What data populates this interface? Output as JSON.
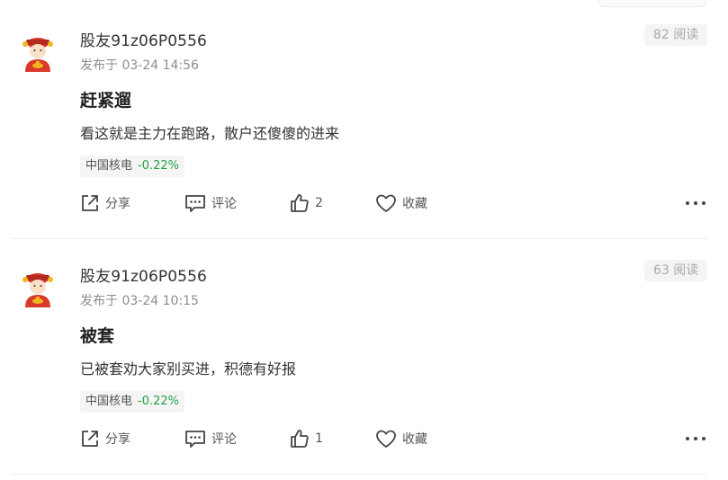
{
  "feed": {
    "posts": [
      {
        "author": "股友91z06P0556",
        "time": "发布于 03-24 14:56",
        "read_count": "82 阅读",
        "title": "赶紧遛",
        "content": "看这就是主力在跑路，散户还傻傻的进来",
        "stock": {
          "name": "中国核电",
          "change": "-0.22%"
        },
        "actions": {
          "share": "分享",
          "comment": "评论",
          "like_count": "2",
          "favorite": "收藏"
        }
      },
      {
        "author": "股友91z06P0556",
        "time": "发布于 03-24 10:15",
        "read_count": "63 阅读",
        "title": "被套",
        "content": "已被套劝大家别买进，积德有好报",
        "stock": {
          "name": "中国核电",
          "change": "-0.22%"
        },
        "actions": {
          "share": "分享",
          "comment": "评论",
          "like_count": "1",
          "favorite": "收藏"
        }
      }
    ]
  },
  "colors": {
    "change_positive_green": "#22a045",
    "meta_gray": "#8c8c8c",
    "badge_bg": "#f4f4f4",
    "avatar_red": "#d93a2b",
    "avatar_gold": "#f2b51d"
  },
  "icons": [
    "avatar-fortune-god-icon",
    "share-icon",
    "comment-icon",
    "like-icon",
    "heart-icon",
    "more-icon"
  ]
}
